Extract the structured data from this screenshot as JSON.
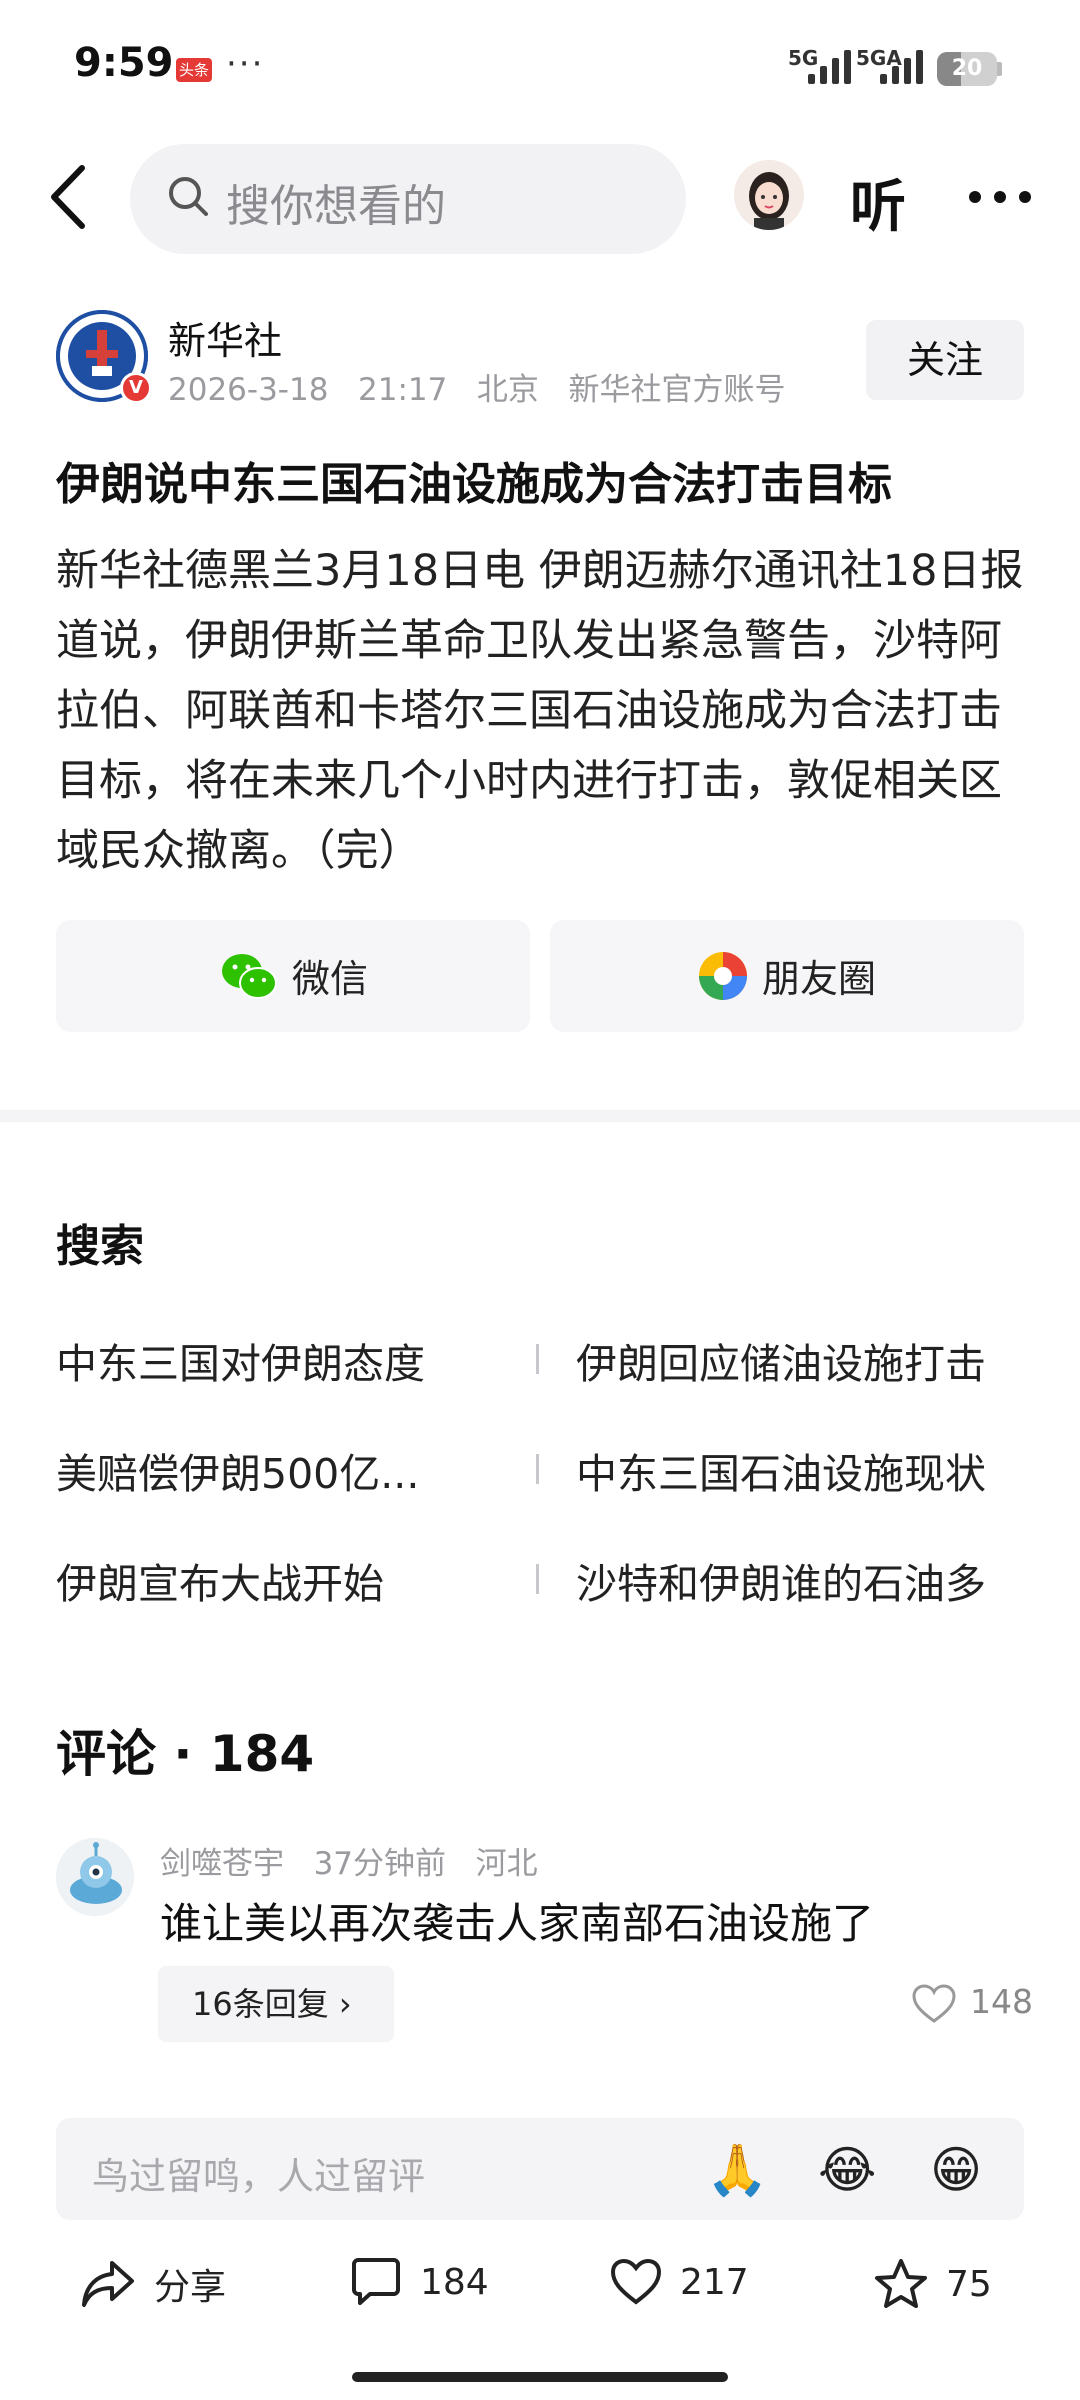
{
  "status_bar": {
    "time": "9:59",
    "app_badge": "头条",
    "dots": "···",
    "network_1": "5G",
    "network_2": "5GA",
    "battery": "20"
  },
  "top_nav": {
    "search_placeholder": "搜你想看的",
    "listen_label": "听"
  },
  "article": {
    "author": "新华社",
    "date": "2026-3-18",
    "time": "21:17",
    "location": "北京",
    "account_desc": "新华社官方账号",
    "follow_label": "关注",
    "title": "伊朗说中东三国石油设施成为合法打击目标",
    "body": "新华社德黑兰3月18日电 伊朗迈赫尔通讯社18日报道说，伊朗伊斯兰革命卫队发出紧急警告，沙特阿拉伯、阿联酋和卡塔尔三国石油设施成为合法打击目标，将在未来几个小时内进行打击，敦促相关区域民众撤离。（完）",
    "share_wechat": "微信",
    "share_moments": "朋友圈"
  },
  "search_section": {
    "title": "搜索",
    "suggestions": [
      "中东三国对伊朗态度",
      "伊朗回应储油设施打击",
      "美赔偿伊朗500亿...",
      "中东三国石油设施现状",
      "伊朗宣布大战开始",
      "沙特和伊朗谁的石油多"
    ]
  },
  "comments": {
    "title": "评论 · 184",
    "items": [
      {
        "user": "剑噬苍宇",
        "time": "37分钟前",
        "location": "河北",
        "text": "谁让美以再次袭击人家南部石油设施了",
        "replies": "16条回复 ›",
        "likes": "148"
      }
    ],
    "input_placeholder": "鸟过留鸣，人过留评",
    "emojis": [
      "🙏",
      "😂",
      "😁"
    ]
  },
  "bottom_bar": {
    "share": "分享",
    "comments": "184",
    "likes": "217",
    "favorites": "75"
  }
}
